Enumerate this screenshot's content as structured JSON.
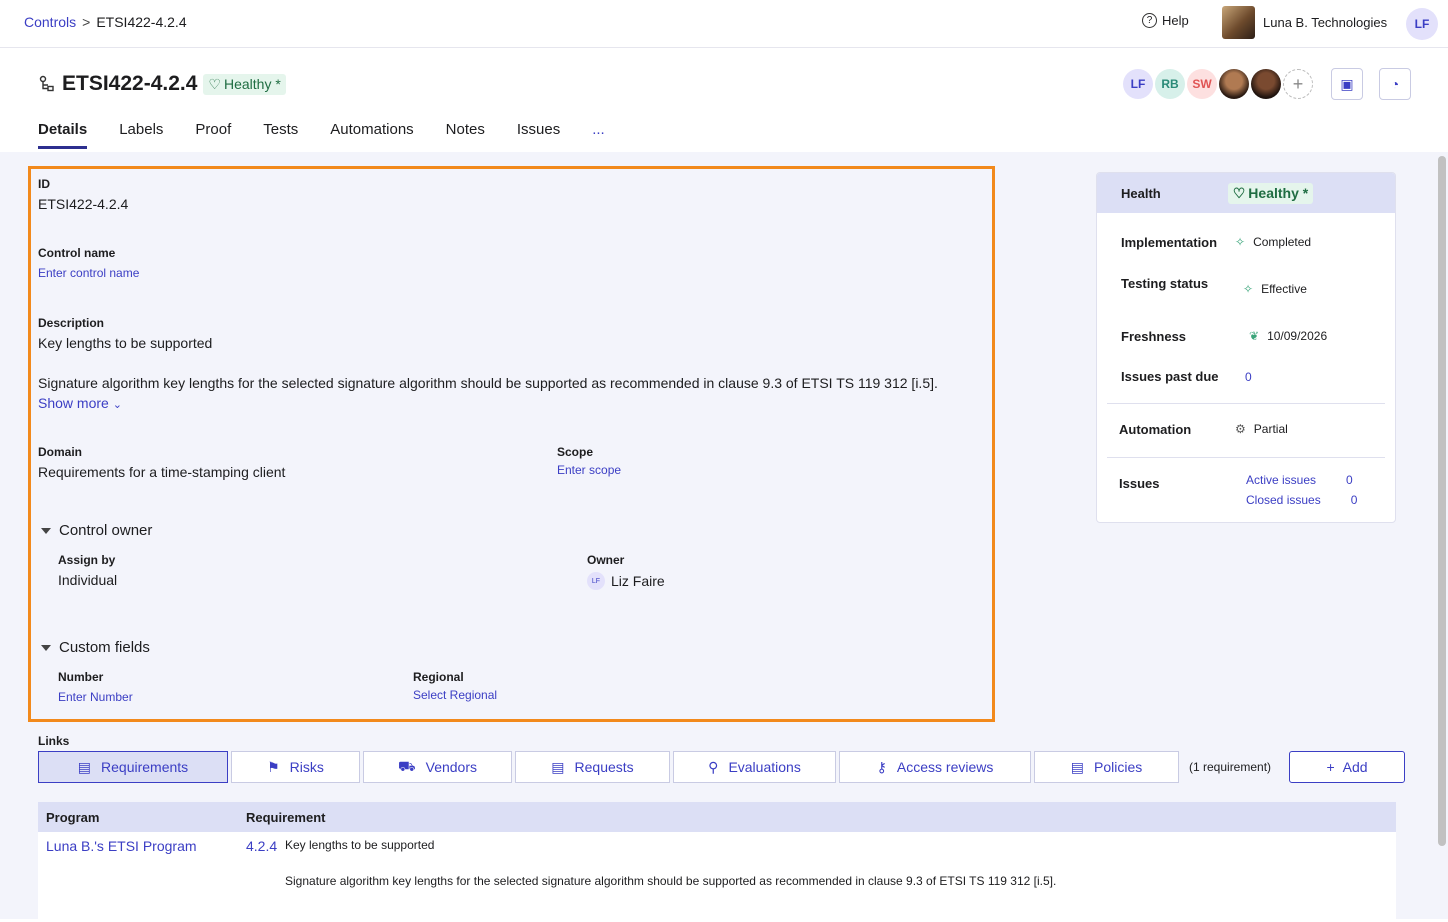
{
  "breadcrumb": {
    "root": "Controls",
    "sep": ">",
    "current": "ETSI422-4.2.4"
  },
  "topbar": {
    "help": "Help",
    "org": "Luna B. Technologies",
    "user_initials": "LF"
  },
  "control": {
    "title": "ETSI422-4.2.4",
    "health_badge": "Healthy *"
  },
  "collaborators": [
    {
      "initials": "LF",
      "bg": "#e3e1fb",
      "color": "#3b3ec4"
    },
    {
      "initials": "RB",
      "bg": "#d7f0ea",
      "color": "#2a8a78"
    },
    {
      "initials": "SW",
      "bg": "#fde0e0",
      "color": "#e05454"
    }
  ],
  "tabs": [
    "Details",
    "Labels",
    "Proof",
    "Tests",
    "Automations",
    "Notes",
    "Issues",
    "..."
  ],
  "details": {
    "id_label": "ID",
    "id_value": "ETSI422-4.2.4",
    "name_label": "Control name",
    "name_placeholder": "Enter control name",
    "desc_label": "Description",
    "desc_title": "Key lengths to be supported",
    "desc_body": "Signature algorithm key lengths for the selected signature algorithm should be supported as recommended in clause 9.3 of ETSI TS 119 312 [i.5].",
    "show_more": "Show more",
    "domain_label": "Domain",
    "domain_value": "Requirements for a time-stamping client",
    "scope_label": "Scope",
    "scope_placeholder": "Enter scope",
    "owner_section": "Control owner",
    "assign_label": "Assign by",
    "assign_value": "Individual",
    "owner_label": "Owner",
    "owner_value": "Liz Faire",
    "owner_initials": "LF",
    "custom_section": "Custom fields",
    "number_label": "Number",
    "number_placeholder": "Enter Number",
    "regional_label": "Regional",
    "regional_placeholder": "Select Regional"
  },
  "sidebar": {
    "health_label": "Health",
    "health_value": "Healthy *",
    "impl_label": "Implementation",
    "impl_value": "Completed",
    "testing_label": "Testing status",
    "testing_value": "Effective",
    "fresh_label": "Freshness",
    "fresh_value": "10/09/2026",
    "past_due_label": "Issues past due",
    "past_due_value": "0",
    "auto_label": "Automation",
    "auto_value": "Partial",
    "issues_label": "Issues",
    "active_label": "Active issues",
    "active_value": "0",
    "closed_label": "Closed issues",
    "closed_value": "0"
  },
  "links": {
    "label": "Links",
    "tabs": [
      "Requirements",
      "Risks",
      "Vendors",
      "Requests",
      "Evaluations",
      "Access reviews",
      "Policies"
    ],
    "count": "(1 requirement)",
    "add": "Add"
  },
  "table": {
    "headers": [
      "Program",
      "Requirement"
    ],
    "rows": [
      {
        "program": "Luna B.'s ETSI Program",
        "code": "4.2.4",
        "title": "Key lengths to be supported",
        "body": "Signature algorithm key lengths for the selected signature algorithm should be supported as recommended in clause 9.3 of ETSI TS 119 312 [i.5]."
      }
    ]
  }
}
